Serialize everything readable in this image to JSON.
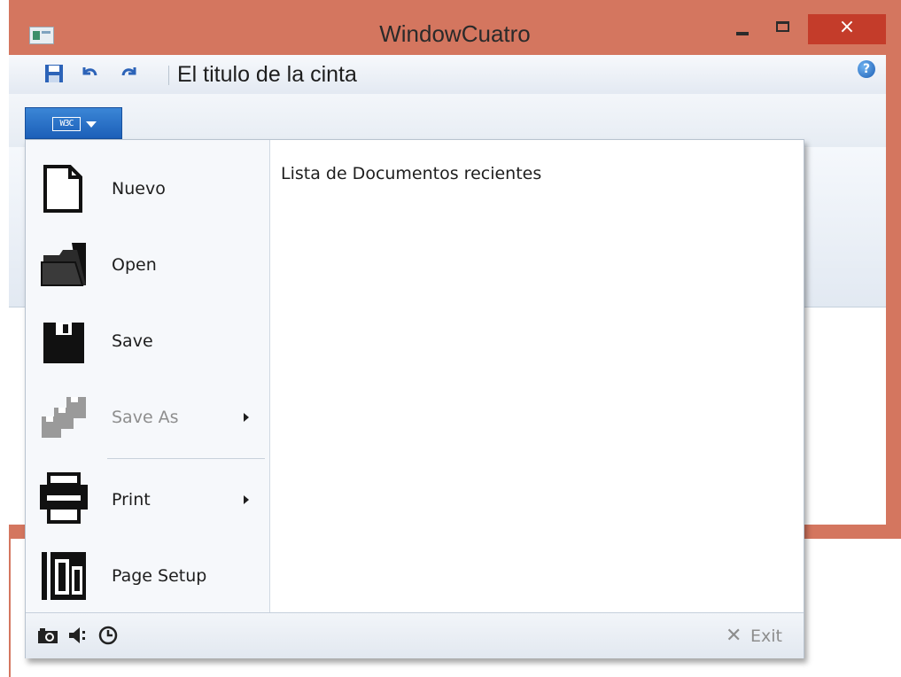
{
  "window": {
    "title": "WindowCuatro",
    "close_glyph": "×"
  },
  "ribbon": {
    "title": "El titulo de la cinta",
    "help_glyph": "?",
    "app_button_logo": "W3C"
  },
  "app_menu": {
    "items": [
      {
        "label": "Nuevo",
        "icon": "new-document-icon",
        "enabled": true,
        "has_submenu": false
      },
      {
        "label": "Open",
        "icon": "open-folder-icon",
        "enabled": true,
        "has_submenu": false
      },
      {
        "label": "Save",
        "icon": "save-icon",
        "enabled": true,
        "has_submenu": false
      },
      {
        "label": "Save As",
        "icon": "save-as-icon",
        "enabled": false,
        "has_submenu": true
      },
      {
        "label": "Print",
        "icon": "printer-icon",
        "enabled": true,
        "has_submenu": true
      },
      {
        "label": "Page Setup",
        "icon": "page-setup-icon",
        "enabled": true,
        "has_submenu": false
      }
    ],
    "recent_title": "Lista de Documentos recientes",
    "footer": {
      "icons": [
        "camera-icon",
        "speaker-icon",
        "clock-icon"
      ],
      "exit_label": "Exit",
      "exit_glyph": "✕"
    }
  },
  "colors": {
    "window_frame": "#d4765f",
    "close_button": "#c43c2a",
    "app_button": "#1c5fb8",
    "disabled_text": "#8e8e8e"
  }
}
